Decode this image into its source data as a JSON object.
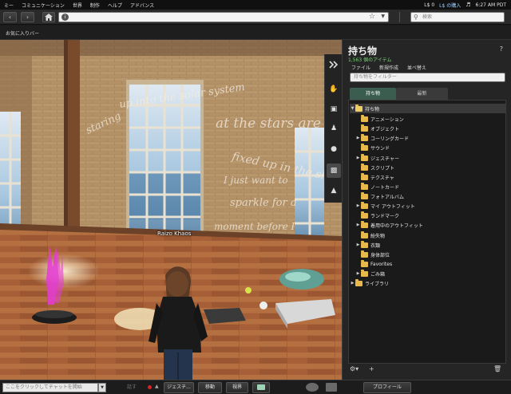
{
  "menubar": {
    "items": [
      "ミー",
      "コミュニケーション",
      "世界",
      "制作",
      "ヘルプ",
      "アドバンス"
    ],
    "balance": "L$ 0",
    "buy_label": "L$ の購入",
    "time": "6:27 AM PDT"
  },
  "navbar": {
    "search_placeholder": "検索"
  },
  "favorites": {
    "label": "お気に入りバー"
  },
  "viewport": {
    "avatar_name": "Raizo Khaos",
    "wall_text": [
      "up into the solar system",
      "staring",
      "at the stars are",
      "fixed up in the sky",
      "I just want to",
      "sparkle for a",
      "moment before I"
    ]
  },
  "sidebar": {
    "tabs": [
      "expand-icon",
      "home-icon",
      "people-icon",
      "places-icon",
      "appearance-icon",
      "inventory-icon",
      "outfit-icon"
    ]
  },
  "inventory": {
    "title": "持ち物",
    "help": "?",
    "item_count": "1,563 個のアイテム",
    "menu": [
      "ファイル",
      "新規作成",
      "並べ替え"
    ],
    "filter_placeholder": "持ち物をフィルター",
    "tabs": [
      "持ち物",
      "最新"
    ],
    "tree": [
      {
        "label": "持ち物",
        "depth": 0,
        "expanded": true,
        "arrow": true
      },
      {
        "label": "アニメーション",
        "depth": 1,
        "arrow": false
      },
      {
        "label": "オブジェクト",
        "depth": 1,
        "arrow": false
      },
      {
        "label": "コーリングカード",
        "depth": 1,
        "arrow": true
      },
      {
        "label": "サウンド",
        "depth": 1,
        "arrow": false
      },
      {
        "label": "ジェスチャー",
        "depth": 1,
        "arrow": true
      },
      {
        "label": "スクリプト",
        "depth": 1,
        "arrow": false
      },
      {
        "label": "テクスチャ",
        "depth": 1,
        "arrow": false
      },
      {
        "label": "ノートカード",
        "depth": 1,
        "arrow": false
      },
      {
        "label": "フォトアルバム",
        "depth": 1,
        "arrow": false
      },
      {
        "label": "マイ アウトフィット",
        "depth": 1,
        "arrow": true
      },
      {
        "label": "ランドマーク",
        "depth": 1,
        "arrow": false
      },
      {
        "label": "着用中のアウトフィット",
        "depth": 1,
        "arrow": true
      },
      {
        "label": "紛失物",
        "depth": 1,
        "arrow": false
      },
      {
        "label": "衣類",
        "depth": 1,
        "arrow": true
      },
      {
        "label": "身体部位",
        "depth": 1,
        "arrow": false
      },
      {
        "label": "Favorites",
        "depth": 1,
        "arrow": false
      },
      {
        "label": "ごみ箱",
        "depth": 1,
        "arrow": true
      },
      {
        "label": "ライブラリ",
        "depth": 0,
        "expanded": false,
        "arrow": true
      }
    ]
  },
  "bottombar": {
    "chat_placeholder": "ここをクリックしてチャットを開始",
    "speak": "話す",
    "gestures": "ジェスチ...",
    "move": "移動",
    "view": "視界",
    "profile": "プロフィール"
  }
}
